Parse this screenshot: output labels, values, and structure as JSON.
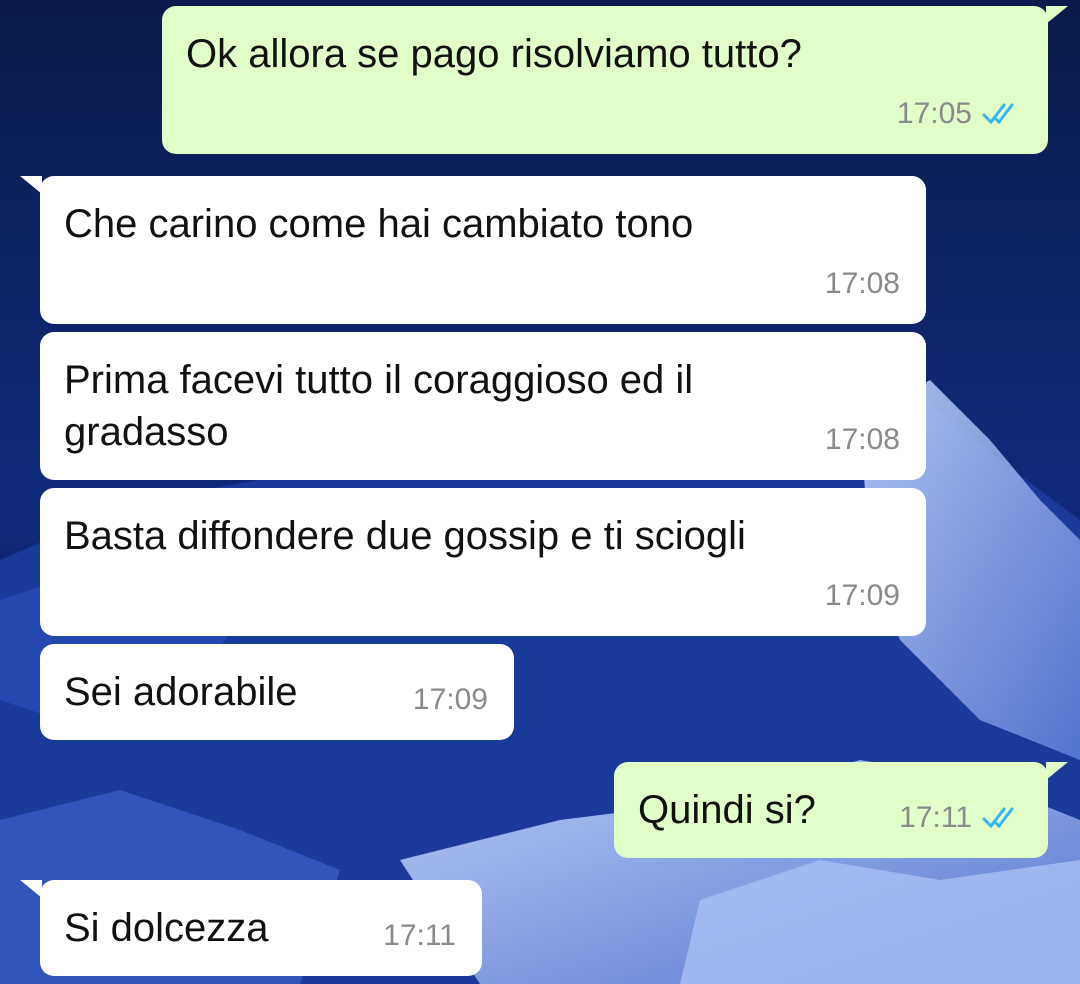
{
  "colors": {
    "outgoing_bubble": "#e1fec8",
    "incoming_bubble": "#ffffff",
    "read_ticks": "#34b7f1",
    "timestamp": "#8a8a8a"
  },
  "background": {
    "description_icon": "snowy-mountain-wallpaper"
  },
  "messages": [
    {
      "direction": "outgoing",
      "text": "Ok allora se pago risolviamo tutto?",
      "time": "17:05",
      "status": "read"
    },
    {
      "direction": "incoming",
      "text": "Che carino come hai cambiato tono",
      "time": "17:08"
    },
    {
      "direction": "incoming",
      "text": "Prima facevi tutto il coraggioso ed il\ngradasso",
      "time": "17:08"
    },
    {
      "direction": "incoming",
      "text": "Basta diffondere due gossip e ti sciogli",
      "time": "17:09"
    },
    {
      "direction": "incoming",
      "text": "Sei adorabile",
      "time": "17:09"
    },
    {
      "direction": "outgoing",
      "text": "Quindi si?",
      "time": "17:11",
      "status": "read"
    },
    {
      "direction": "incoming",
      "text": "Si dolcezza",
      "time": "17:11"
    }
  ]
}
